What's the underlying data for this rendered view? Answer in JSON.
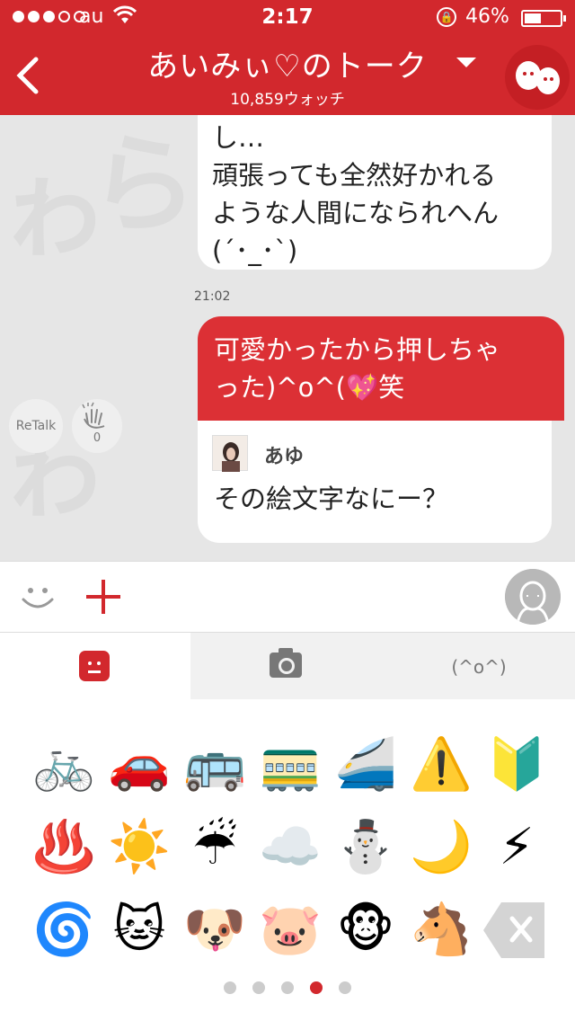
{
  "status_bar": {
    "signal_dots_filled": 3,
    "signal_dots_total": 5,
    "carrier": "au",
    "time": "2:17",
    "battery_text": "46%",
    "battery_level": 0.46
  },
  "header": {
    "title": "あいみぃ♡のトーク",
    "watch_count": "10,859ウォッチ",
    "back_icon": "chevron-left-icon",
    "dropdown_icon": "caret-down-icon",
    "brand_color": "#d2282d"
  },
  "messages": {
    "partial_bubble_text": "し…\n頑張っても全然好かれる\nような人間になられへん\n(´･_･`)",
    "timestamp": "21:02",
    "sent_text": "可愛かったから押しちゃ\nった)^o^(💖笑",
    "quoted_reply": {
      "name": "あゆ",
      "text": "その絵文字なにー？"
    },
    "retalk_label": "ReTalk",
    "clap_count": "0"
  },
  "input_bar": {
    "smiley_icon": "smiley-icon",
    "plus_icon": "plus-icon",
    "avatar_icon": "user-avatar-icon"
  },
  "tabs": [
    {
      "name": "emoji",
      "icon": "emoji-face-icon",
      "active": true
    },
    {
      "name": "camera",
      "icon": "camera-icon",
      "active": false
    },
    {
      "name": "kaomoji",
      "label": "(^o^)",
      "active": false
    }
  ],
  "emoji_grid": [
    [
      "🚲",
      "🚗",
      "🚌",
      "🚃",
      "🚄",
      "⚠️",
      "🔰"
    ],
    [
      "♨️",
      "☀️",
      "☔",
      "☁️",
      "⛄",
      "🌙",
      "⚡"
    ],
    [
      "🌀",
      "🐱",
      "🐶",
      "🐷",
      "🐵",
      "🐴"
    ]
  ],
  "emoji_names": [
    [
      "bicycle-emoji",
      "car-emoji",
      "bus-emoji",
      "train-emoji",
      "bullet-train-emoji",
      "warning-emoji",
      "beginner-mark-emoji"
    ],
    [
      "hot-springs-emoji",
      "sun-emoji",
      "umbrella-rain-emoji",
      "cloud-emoji",
      "snowman-emoji",
      "moon-emoji",
      "lightning-emoji"
    ],
    [
      "cyclone-emoji",
      "cat-emoji",
      "dog-emoji",
      "pig-emoji",
      "monkey-emoji",
      "horse-emoji"
    ]
  ],
  "pager": {
    "total": 5,
    "active_index": 3
  },
  "backspace_icon": "backspace-icon"
}
